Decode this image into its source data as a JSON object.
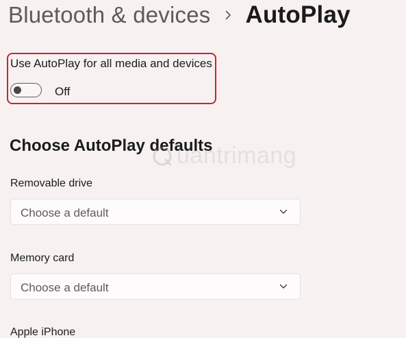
{
  "breadcrumb": {
    "parent": "Bluetooth & devices",
    "separator_icon": "chevron-right-icon",
    "current": "AutoPlay"
  },
  "autoplay_setting": {
    "label": "Use AutoPlay for all media and devices",
    "state": "Off",
    "enabled": false,
    "highlight_color": "#d0202c"
  },
  "defaults_section": {
    "title": "Choose AutoPlay defaults",
    "items": [
      {
        "label": "Removable drive",
        "value": "Choose a default"
      },
      {
        "label": "Memory card",
        "value": "Choose a default"
      },
      {
        "label": "Apple iPhone"
      }
    ]
  },
  "watermark": {
    "text": "uantrimang",
    "icon": "quantrimang-logo-icon"
  }
}
